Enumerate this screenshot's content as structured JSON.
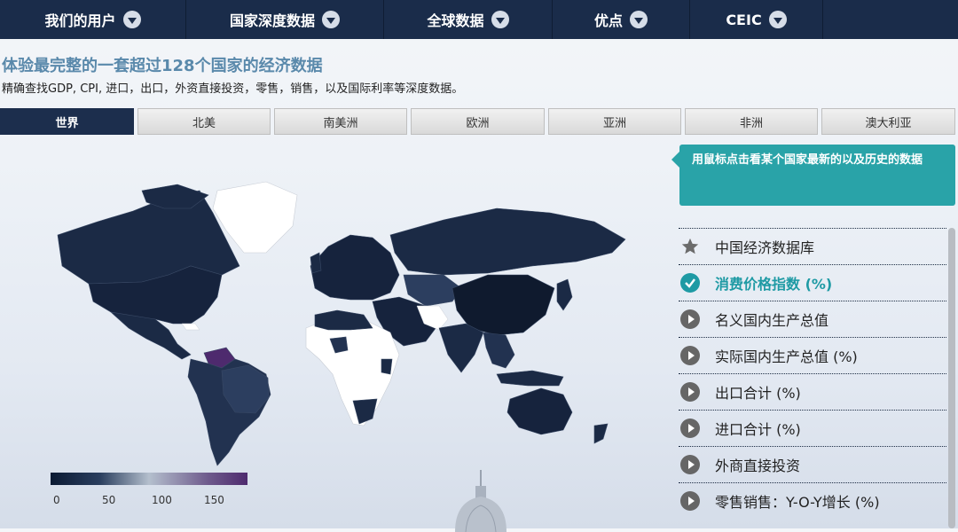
{
  "nav": [
    {
      "label": "我们的用户"
    },
    {
      "label": "国家深度数据"
    },
    {
      "label": "全球数据"
    },
    {
      "label": "优点"
    },
    {
      "label": "CEIC"
    }
  ],
  "headline": "体验最完整的一套超过128个国家的经济数据",
  "subline": "精确查找GDP, CPI, 进口，出口，外资直接投资，零售，销售，以及国际利率等深度数据。",
  "tabs": [
    {
      "label": "世界",
      "active": true
    },
    {
      "label": "北美"
    },
    {
      "label": "南美洲"
    },
    {
      "label": "欧洲"
    },
    {
      "label": "亚洲"
    },
    {
      "label": "非洲"
    },
    {
      "label": "澳大利亚"
    }
  ],
  "legend": {
    "ticks": [
      "0",
      "50",
      "100",
      "150"
    ]
  },
  "hint": "用鼠标点击看某个国家最新的以及历史的数据",
  "list": [
    {
      "label": "中国经济数据库",
      "icon": "star-icon"
    },
    {
      "label": "消费价格指数 (%)",
      "icon": "check-icon",
      "selected": true
    },
    {
      "label": "名义国内生产总值",
      "icon": "play-icon"
    },
    {
      "label": "实际国内生产总值 (%)",
      "icon": "play-icon"
    },
    {
      "label": "出口合计 (%)",
      "icon": "play-icon"
    },
    {
      "label": "进口合计 (%)",
      "icon": "play-icon"
    },
    {
      "label": "外商直接投资",
      "icon": "play-icon"
    },
    {
      "label": "零售销售：Y-O-Y增长 (%)",
      "icon": "play-icon"
    }
  ],
  "colors": {
    "nav": "#1a2c4a",
    "accent": "#29a3a8",
    "map_dark": "#1b2a45",
    "map_none": "#ffffff"
  }
}
